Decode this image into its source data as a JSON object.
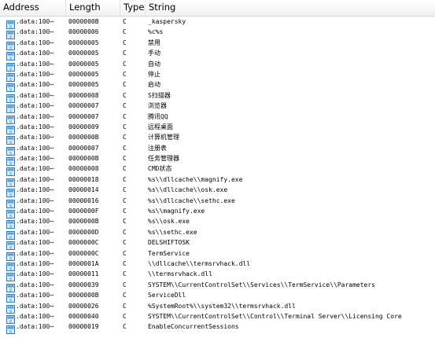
{
  "header": {
    "address": "Address",
    "length": "Length",
    "type": "Type",
    "string": "String"
  },
  "icon": "string-item-icon",
  "rows": [
    {
      "address": ".data:100⋯",
      "length": "0000000B",
      "type": "C",
      "string": "_kaspersky"
    },
    {
      "address": ".data:100⋯",
      "length": "00000006",
      "type": "C",
      "string": " %c%s"
    },
    {
      "address": ".data:100⋯",
      "length": "00000005",
      "type": "C",
      "string": "禁用"
    },
    {
      "address": ".data:100⋯",
      "length": "00000005",
      "type": "C",
      "string": "手动"
    },
    {
      "address": ".data:100⋯",
      "length": "00000005",
      "type": "C",
      "string": "自动"
    },
    {
      "address": ".data:100⋯",
      "length": "00000005",
      "type": "C",
      "string": "停止"
    },
    {
      "address": ".data:100⋯",
      "length": "00000005",
      "type": "C",
      "string": "启动"
    },
    {
      "address": ".data:100⋯",
      "length": "00000008",
      "type": "C",
      "string": "S扫描器"
    },
    {
      "address": ".data:100⋯",
      "length": "00000007",
      "type": "C",
      "string": "浏览器"
    },
    {
      "address": ".data:100⋯",
      "length": "00000007",
      "type": "C",
      "string": "腾讯QQ"
    },
    {
      "address": ".data:100⋯",
      "length": "00000009",
      "type": "C",
      "string": "远程桌面"
    },
    {
      "address": ".data:100⋯",
      "length": "0000000B",
      "type": "C",
      "string": "计算机管理"
    },
    {
      "address": ".data:100⋯",
      "length": "00000007",
      "type": "C",
      "string": "注册表"
    },
    {
      "address": ".data:100⋯",
      "length": "0000000B",
      "type": "C",
      "string": "任务管理器"
    },
    {
      "address": ".data:100⋯",
      "length": "00000008",
      "type": "C",
      "string": "CMD状态"
    },
    {
      "address": ".data:100⋯",
      "length": "00000018",
      "type": "C",
      "string": "%s\\\\dllcache\\\\magnify.exe"
    },
    {
      "address": ".data:100⋯",
      "length": "00000014",
      "type": "C",
      "string": "%s\\\\dllcache\\\\osk.exe"
    },
    {
      "address": ".data:100⋯",
      "length": "00000016",
      "type": "C",
      "string": "%s\\\\dllcache\\\\sethc.exe"
    },
    {
      "address": ".data:100⋯",
      "length": "0000000F",
      "type": "C",
      "string": "%s\\\\magnify.exe"
    },
    {
      "address": ".data:100⋯",
      "length": "0000000B",
      "type": "C",
      "string": "%s\\\\osk.exe"
    },
    {
      "address": ".data:100⋯",
      "length": "0000000D",
      "type": "C",
      "string": "%s\\\\sethc.exe"
    },
    {
      "address": ".data:100⋯",
      "length": "0000000C",
      "type": "C",
      "string": "DELSHIFTOSK"
    },
    {
      "address": ".data:100⋯",
      "length": "0000000C",
      "type": "C",
      "string": "TermService"
    },
    {
      "address": ".data:100⋯",
      "length": "0000001A",
      "type": "C",
      "string": "\\\\dllcache\\\\termsrvhack.dll"
    },
    {
      "address": ".data:100⋯",
      "length": "00000011",
      "type": "C",
      "string": "\\\\termsrvhack.dll"
    },
    {
      "address": ".data:100⋯",
      "length": "00000039",
      "type": "C",
      "string": "SYSTEM\\\\CurrentControlSet\\\\Services\\\\TermService\\\\Parameters"
    },
    {
      "address": ".data:100⋯",
      "length": "0000000B",
      "type": "C",
      "string": "ServiceDll"
    },
    {
      "address": ".data:100⋯",
      "length": "00000026",
      "type": "C",
      "string": "%SystemRoot%\\\\system32\\\\termsrvhack.dll"
    },
    {
      "address": ".data:100⋯",
      "length": "00000040",
      "type": "C",
      "string": "SYSTEM\\\\CurrentControlSet\\\\Control\\\\Terminal Server\\\\Licensing Core"
    },
    {
      "address": ".data:100⋯",
      "length": "00000019",
      "type": "C",
      "string": "EnableConcurrentSessions"
    }
  ]
}
